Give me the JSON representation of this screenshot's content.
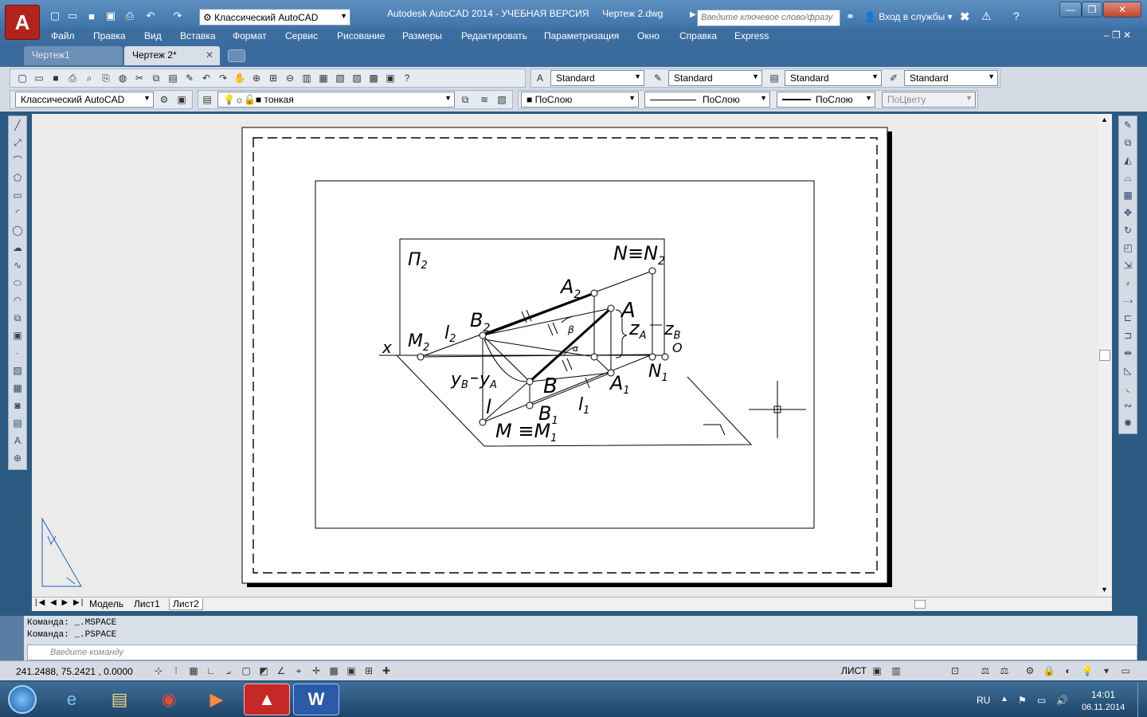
{
  "titlebar": {
    "title": "Autodesk AutoCAD 2014 - УЧЕБНАЯ ВЕРСИЯ     Чертеж 2.dwg",
    "workspace": "Классический AutoCAD",
    "search_placeholder": "Введите ключевое слово/фразу",
    "signin": "Вход в службы"
  },
  "menu": [
    "Файл",
    "Правка",
    "Вид",
    "Вставка",
    "Формат",
    "Сервис",
    "Рисование",
    "Размеры",
    "Редактировать",
    "Параметризация",
    "Окно",
    "Справка",
    "Express"
  ],
  "tabs": [
    {
      "label": "Чертеж1",
      "active": false
    },
    {
      "label": "Чертеж 2*",
      "active": true
    }
  ],
  "styles": {
    "text": "Standard",
    "dim": "Standard",
    "table": "Standard",
    "mleader": "Standard"
  },
  "layers": {
    "workspace": "Классический AutoCAD",
    "layer": "тонкая",
    "color": "ПоСлою",
    "linetype": "ПоСлою",
    "lineweight": "ПоСлою",
    "plotstyle": "ПоЦвету"
  },
  "layout_tabs": [
    "Модель",
    "Лист1",
    "Лист2"
  ],
  "command": {
    "lines": [
      "Команда:  _.MSPACE",
      "Команда:  _.PSPACE"
    ],
    "placeholder": "Введите команду"
  },
  "status": {
    "coords": "241.2488,  75.2421  , 0.0000",
    "space": "ЛИСТ"
  },
  "drawing": {
    "p2": "П",
    "p2sub": "2",
    "nn": "N≡N",
    "nnsub": "2",
    "a2": "A",
    "a2sub": "2",
    "a": "A",
    "b2": "B",
    "b2sub": "2",
    "l2": "l",
    "l2sub": "2",
    "m2": "M",
    "m2sub": "2",
    "x": "x",
    "za": "z",
    "zasub": "A",
    "zb": "z",
    "zbsub": "B",
    "o": "O",
    "n1": "N",
    "n1sub": "1",
    "yb": "y",
    "ybsub": "B",
    "ya": "y",
    "yasub": "A",
    "b": "B",
    "a1": "A",
    "a1sub": "1",
    "l": "l",
    "b1": "B",
    "b1sub": "1",
    "l1": "l",
    "l1sub": "1",
    "mm": "M ≡M",
    "mmsub": "1",
    "beta": "β",
    "alpha": "α",
    "dash": "–"
  },
  "tray": {
    "lang": "RU",
    "time": "14:01",
    "date": "06.11.2014"
  }
}
